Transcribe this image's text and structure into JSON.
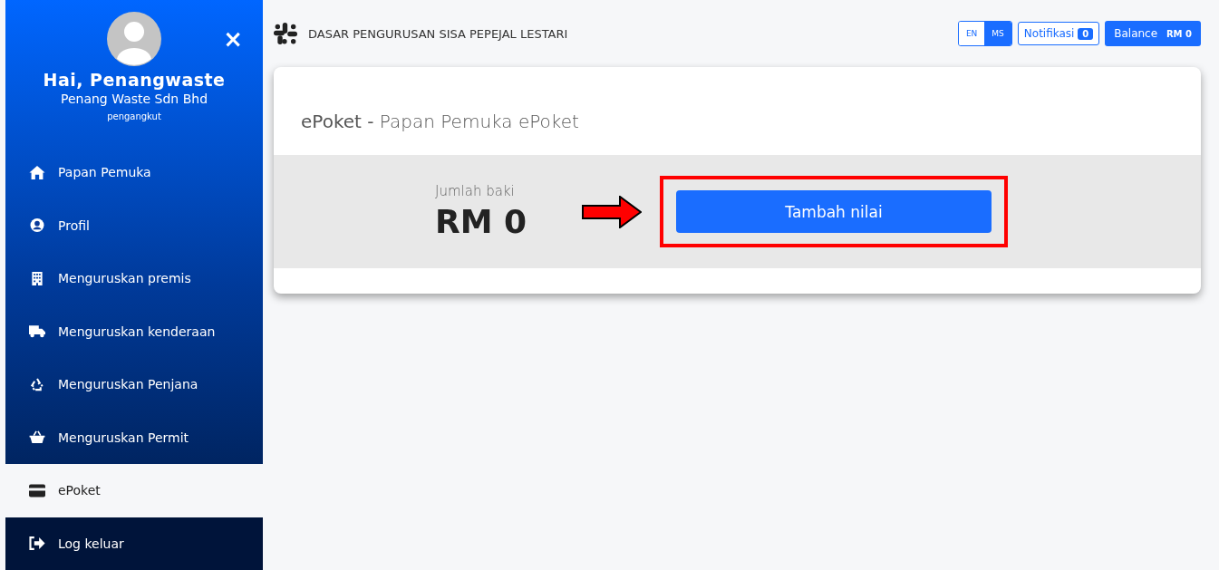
{
  "sidebar": {
    "close": "×",
    "greeting": "Hai, Penangwaste",
    "company": "Penang Waste Sdn Bhd",
    "role": "pengangkut",
    "items": [
      {
        "kind": "home",
        "label": "Papan Pemuka",
        "selected": false
      },
      {
        "kind": "user",
        "label": "Profil",
        "selected": false
      },
      {
        "kind": "building",
        "label": "Menguruskan premis",
        "selected": false
      },
      {
        "kind": "truck",
        "label": "Menguruskan kenderaan",
        "selected": false
      },
      {
        "kind": "recycle",
        "label": "Menguruskan Penjana",
        "selected": false
      },
      {
        "kind": "basket",
        "label": "Menguruskan Permit",
        "selected": false
      },
      {
        "kind": "card",
        "label": "ePoket",
        "selected": true
      },
      {
        "kind": "logout",
        "label": "Log keluar",
        "selected": false
      }
    ]
  },
  "topbar": {
    "title": "DASAR PENGURUSAN SISA PEPEJAL LESTARI",
    "languages": [
      {
        "label": "EN",
        "selected": false
      },
      {
        "label": "MS",
        "selected": true
      }
    ],
    "notifications": {
      "label": "Notifikasi",
      "count": "0"
    },
    "balance": {
      "label": "Balance",
      "amount": "RM 0"
    }
  },
  "card": {
    "title": "**ePoket -** Papan Pemuka ePoket",
    "balance_label": "Jumlah baki",
    "balance": "RM 0",
    "button": "Tambah nilai"
  }
}
